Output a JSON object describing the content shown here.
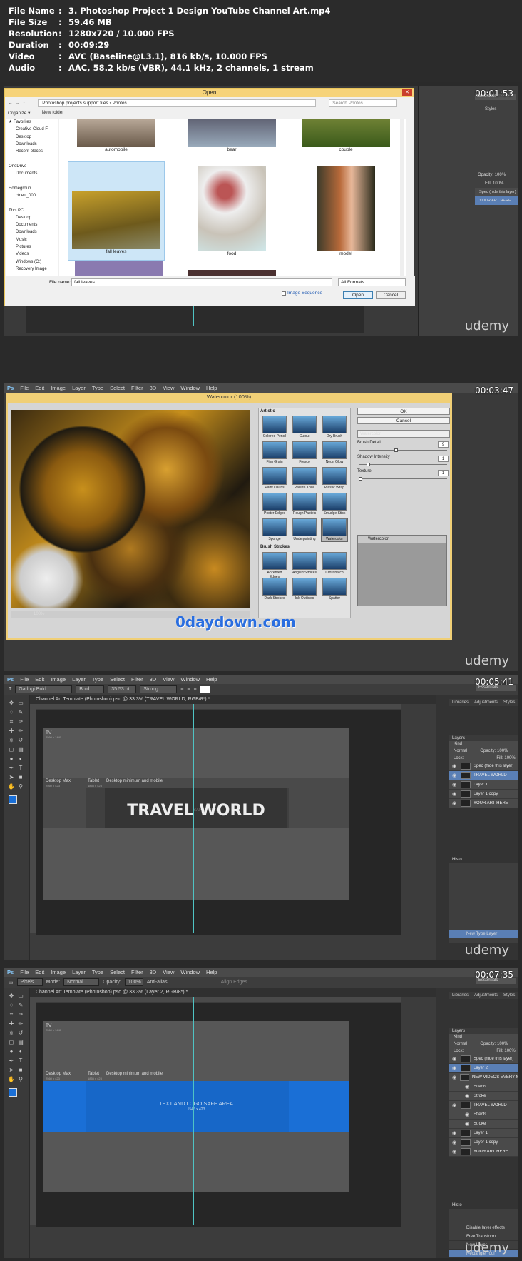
{
  "header": {
    "rows": [
      {
        "label": "File Name",
        "value": "3. Photoshop Project 1 Design YouTube Channel Art.mp4"
      },
      {
        "label": "File Size",
        "value": "59.46 MB"
      },
      {
        "label": "Resolution",
        "value": "1280x720 / 10.000 FPS"
      },
      {
        "label": "Duration",
        "value": "00:09:29"
      },
      {
        "label": "Video",
        "value": "AVC (Baseline@L3.1), 816 kb/s, 10.000 FPS"
      },
      {
        "label": "Audio",
        "value": "AAC, 58.2 kb/s (VBR), 44.1 kHz, 2 channels, 1 stream"
      }
    ]
  },
  "watermark": "udemy",
  "frame1": {
    "timestamp": "00:01:53",
    "dialog": {
      "title": "Open",
      "path": "Photoshop projects support files  ›  Photos",
      "search_placeholder": "Search Photos",
      "organize": "Organize ▾",
      "new_folder": "New folder",
      "nav": [
        "★ Favorites",
        "Creative Cloud Fi",
        "Desktop",
        "Downloads",
        "Recent places",
        "",
        "OneDrive",
        "Documents",
        "",
        "Homegroup",
        "ctneu_000",
        "",
        "This PC",
        "Desktop",
        "Documents",
        "Downloads",
        "Music",
        "Pictures",
        "Videos",
        "Windows (C:)",
        "Recovery Image"
      ],
      "files": [
        "automobile",
        "bear",
        "couple",
        "fall leaves",
        "food",
        "model"
      ],
      "filename_label": "File name:",
      "filename_value": "fall leaves",
      "filter_value": "All Formats",
      "image_sequence": "Image Sequence",
      "open_button": "Open",
      "cancel_button": "Cancel"
    },
    "panel_tab": "Essentials",
    "panel_tabs": [
      "Styles"
    ],
    "layers": [
      "Spec (hide this layer)",
      "YOUR ART HERE"
    ],
    "opacity_label": "Opacity:",
    "opacity_value": "100%",
    "fill_label": "Fill:",
    "fill_value": "100%"
  },
  "frame2": {
    "timestamp": "00:03:47",
    "menu": [
      "File",
      "Edit",
      "Image",
      "Layer",
      "Type",
      "Select",
      "Filter",
      "3D",
      "View",
      "Window",
      "Help"
    ],
    "dialog_title": "Watercolor (100%)",
    "zoom": "100%",
    "group_artistic": "Artistic",
    "artistic": [
      "Colored Pencil",
      "Cutout",
      "Dry Brush",
      "Film Grain",
      "Fresco",
      "Neon Glow",
      "Paint Daubs",
      "Palette Knife",
      "Plastic Wrap",
      "Poster Edges",
      "Rough Pastels",
      "Smudge Stick",
      "Sponge",
      "Underpainting",
      "Watercolor"
    ],
    "group_brush": "Brush Strokes",
    "brush": [
      "Accented Edges",
      "Angled Strokes",
      "Crosshatch",
      "Dark Strokes",
      "Ink Outlines",
      "Spatter"
    ],
    "ok": "OK",
    "cancel": "Cancel",
    "filter_select": "Watercolor",
    "sliders": [
      {
        "label": "Brush Detail",
        "value": "9",
        "level": 0.45
      },
      {
        "label": "Shadow Intensity",
        "value": "1",
        "level": 0.1
      },
      {
        "label": "Texture",
        "value": "1",
        "level": 0.0
      }
    ],
    "effect_layer": "Watercolor",
    "overlay_text": "0daydown.com"
  },
  "frame3": {
    "timestamp": "00:05:41",
    "menu": [
      "File",
      "Edit",
      "Image",
      "Layer",
      "Type",
      "Select",
      "Filter",
      "3D",
      "View",
      "Window",
      "Help"
    ],
    "options": [
      "Gadugi Bold",
      "Bold",
      "35.53 pt",
      "Strong"
    ],
    "doc_tab": "Channel Art Template (Photoshop).psd @ 33.3% (TRAVEL WORLD, RGB/8*) *",
    "panel_tabs": [
      "Libraries",
      "Adjustments",
      "Styles"
    ],
    "panel_tab": "Essentials",
    "tv_label": "TV",
    "tv_size": "2560 x 1440",
    "desktop_max": "Desktop Max",
    "desktop_max_size": "2560 x 423",
    "tablet": "Tablet",
    "tablet_size": "1855 x 423",
    "desktop_min": "Desktop minimum and mobile",
    "main_text": "TRAVEL WORLD",
    "safe_text_faint": "SAFE AREA",
    "layers_title": "Layers",
    "kind": "Kind",
    "blend": "Normal",
    "opacity_label": "Opacity:",
    "opacity_value": "100%",
    "lock_label": "Lock:",
    "fill_label": "Fill:",
    "fill_value": "100%",
    "layers": [
      "Spec (hide this layer)",
      "TRAVEL WORLD",
      "Layer 1",
      "Layer 1 copy",
      "YOUR ART HERE"
    ],
    "history_title": "Histo",
    "history": [
      "New Type Layer"
    ]
  },
  "frame4": {
    "timestamp": "00:07:35",
    "menu": [
      "File",
      "Edit",
      "Image",
      "Layer",
      "Type",
      "Select",
      "Filter",
      "3D",
      "View",
      "Window",
      "Help"
    ],
    "options": [
      "Pixels",
      "Mode:",
      "Normal",
      "Opacity:",
      "100%",
      "Anti-alias",
      "Align Edges"
    ],
    "doc_tab": "Channel Art Template (Photoshop).psd @ 33.3% (Layer 2, RGB/8*) *",
    "panel_tabs": [
      "Libraries",
      "Adjustments",
      "Styles"
    ],
    "panel_tab": "Essentials",
    "tv_label": "TV",
    "tv_size": "2560 x 1440",
    "desktop_max": "Desktop Max",
    "desktop_max_size": "2560 x 423",
    "tablet": "Tablet",
    "tablet_size": "1855 x 423",
    "desktop_min": "Desktop minimum and mobile",
    "safe_title": "TEXT AND LOGO SAFE AREA",
    "safe_size": "1546 x 423",
    "layers_title": "Layers",
    "kind": "Kind",
    "blend": "Normal",
    "opacity_label": "Opacity:",
    "opacity_value": "100%",
    "lock_label": "Lock:",
    "fill_label": "Fill:",
    "fill_value": "100%",
    "layers": [
      "Spec (hide this layer)",
      "Layer 2",
      "NEW VIDEOS EVERY M...",
      "Effects",
      "Stroke",
      "TRAVEL WORLD",
      "Effects",
      "Stroke",
      "Layer 1",
      "Layer 1 copy",
      "YOUR ART HERE"
    ],
    "history_title": "Histo",
    "history": [
      "Disable layer effects",
      "Free Transform",
      "New Layer",
      "Rectangle Tool"
    ]
  },
  "colors": {
    "accent": "#1a6fd6",
    "select": "#5a7fb5",
    "guide": "#4fc3c3",
    "dialog": "#f6d37a"
  }
}
